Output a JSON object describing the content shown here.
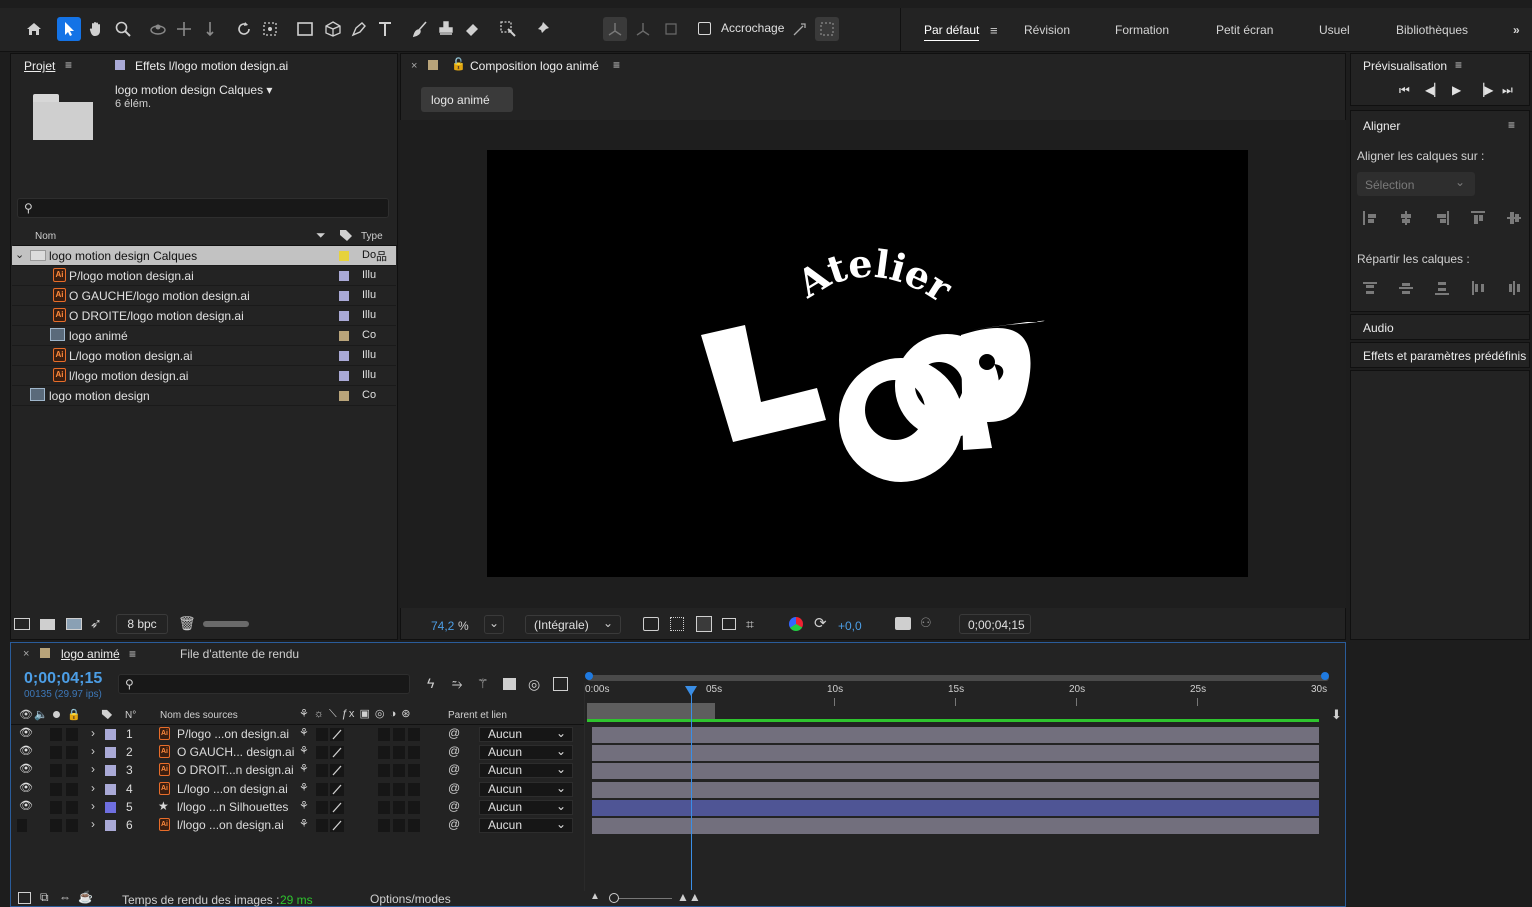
{
  "toolbar": {
    "tools": [
      "home-icon",
      "selection-arrow-icon",
      "hand-icon",
      "zoom-icon",
      "orbit-camera-icon",
      "pan-camera-icon",
      "dolly-camera-icon",
      "rotate-icon",
      "pan-behind-icon",
      "rectangle-icon",
      "3d-cube-icon",
      "pen-icon",
      "text-icon",
      "brush-icon",
      "clone-stamp-icon",
      "eraser-icon",
      "roto-brush-icon",
      "puppet-pin-icon"
    ],
    "snapping_label": "Accrochage",
    "workspaces": [
      "Par défaut",
      "Révision",
      "Formation",
      "Petit écran",
      "Usuel",
      "Bibliothèques"
    ],
    "overflow": "»"
  },
  "project": {
    "tab_label": "Projet",
    "effects_tab_label": "Effets l/logo motion design.ai",
    "selected_name": "logo motion design Calques ▾",
    "selected_count": "6 élém.",
    "search_placeholder": "",
    "col_name": "Nom",
    "col_type": "Type",
    "items": [
      {
        "name": "logo motion design Calques",
        "type": "Do",
        "color": "#e6d23c",
        "kind": "folder",
        "indent": 0
      },
      {
        "name": "P/logo motion design.ai",
        "type": "Illu",
        "color": "#a9a9d6",
        "kind": "ai",
        "indent": 1
      },
      {
        "name": "O GAUCHE/logo motion design.ai",
        "type": "Illu",
        "color": "#a9a9d6",
        "kind": "ai",
        "indent": 1
      },
      {
        "name": "O DROITE/logo motion design.ai",
        "type": "Illu",
        "color": "#a9a9d6",
        "kind": "ai",
        "indent": 1
      },
      {
        "name": "logo animé",
        "type": "Co",
        "color": "#b9a47a",
        "kind": "comp",
        "indent": 1
      },
      {
        "name": "L/logo motion design.ai",
        "type": "Illu",
        "color": "#a9a9d6",
        "kind": "ai",
        "indent": 1
      },
      {
        "name": "l/logo motion design.ai",
        "type": "Illu",
        "color": "#a9a9d6",
        "kind": "ai",
        "indent": 1
      },
      {
        "name": "logo motion design",
        "type": "Co",
        "color": "#b9a47a",
        "kind": "comp",
        "indent": 0
      }
    ],
    "bpc_label": "8 bpc"
  },
  "composition": {
    "tab_label": "Composition logo animé",
    "crumb": "logo animé",
    "logo_word_top": "Atelier",
    "logo_word_main": "LOOP",
    "zoom": "74,2",
    "zoom_unit": "%",
    "resolution": "(Intégrale)",
    "exposure": "+0,0",
    "timecode": "0;00;04;15"
  },
  "preview": {
    "title": "Prévisualisation"
  },
  "align": {
    "title": "Aligner",
    "align_to_label": "Aligner les calques sur :",
    "align_to_value": "Sélection",
    "distribute_label": "Répartir les calques :"
  },
  "audio": {
    "title": "Audio"
  },
  "effects_presets": {
    "title": "Effets et paramètres prédéfinis"
  },
  "timeline": {
    "tab_label": "logo animé",
    "render_queue_label": "File d'attente de rendu",
    "timecode": "0;00;04;15",
    "frame_info": "00135 (29.97 ips)",
    "col_num": "N°",
    "col_source": "Nom des sources",
    "col_parent": "Parent et lien",
    "ruler": [
      "0:00s",
      "05s",
      "10s",
      "15s",
      "20s",
      "25s",
      "30s"
    ],
    "playhead_fraction": 0.15,
    "layers": [
      {
        "num": "1",
        "name": "P/logo ...on design.ai",
        "parent": "Aucun",
        "color": "#a9a9d6",
        "kind": "ai",
        "visible": true
      },
      {
        "num": "2",
        "name": "O GAUCH... design.ai",
        "parent": "Aucun",
        "color": "#a9a9d6",
        "kind": "ai",
        "visible": true
      },
      {
        "num": "3",
        "name": "O DROIT...n design.ai",
        "parent": "Aucun",
        "color": "#a9a9d6",
        "kind": "ai",
        "visible": true
      },
      {
        "num": "4",
        "name": "L/logo ...on design.ai",
        "parent": "Aucun",
        "color": "#a9a9d6",
        "kind": "ai",
        "visible": true
      },
      {
        "num": "5",
        "name": "l/logo ...n Silhouettes",
        "parent": "Aucun",
        "color": "#6f6fe0",
        "kind": "shape",
        "visible": true
      },
      {
        "num": "6",
        "name": "l/logo ...on design.ai",
        "parent": "Aucun",
        "color": "#a9a9d6",
        "kind": "ai",
        "visible": false
      }
    ],
    "render_time_label": "Temps de rendu des images :",
    "render_time_value": "29 ms",
    "options_label": "Options/modes"
  }
}
